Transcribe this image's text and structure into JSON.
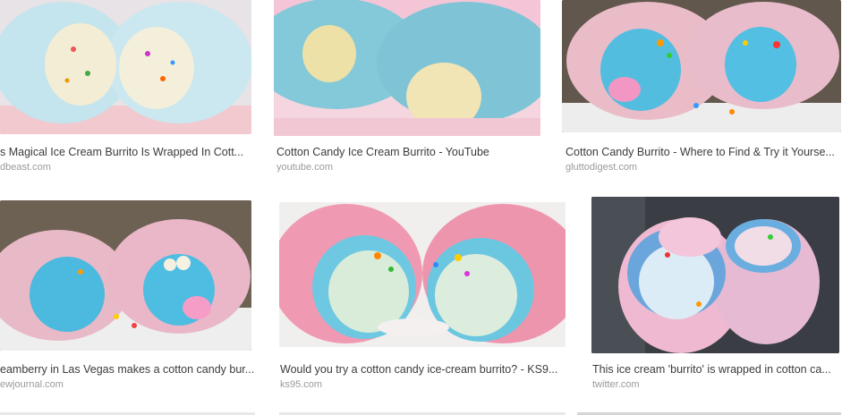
{
  "results": [
    {
      "title": "s Magical Ice Cream Burrito Is Wrapped In Cott...",
      "domain": "dbeast.com"
    },
    {
      "title": "Cotton Candy Ice Cream Burrito - YouTube",
      "domain": "youtube.com"
    },
    {
      "title": "Cotton Candy Burrito - Where to Find & Try it Yourse...",
      "domain": "gluttodigest.com"
    },
    {
      "title": "eamberry in Las Vegas makes a cotton candy bur...",
      "domain": "ewjournal.com"
    },
    {
      "title": "Would you try a cotton candy ice-cream burrito? - KS9...",
      "domain": "ks95.com"
    },
    {
      "title": "This ice cream 'burrito' is wrapped in cotton ca...",
      "domain": "twitter.com"
    }
  ],
  "colors": {
    "caption_text": "#3b3b3b",
    "domain_text": "#9a9a9a",
    "cotton_blue": "#8fd3e3",
    "cotton_pink": "#f3a9c7",
    "ice_cream": "#f1e6c0"
  }
}
